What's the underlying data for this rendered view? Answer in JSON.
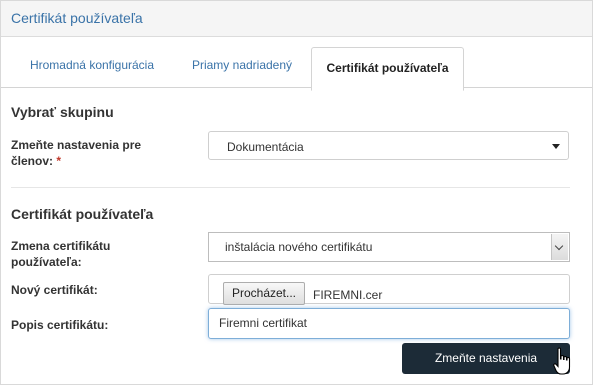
{
  "panel": {
    "title": "Certifikát používateľa"
  },
  "tabs": [
    {
      "label": "Hromadná konfigurácia"
    },
    {
      "label": "Priamy nadriadený"
    },
    {
      "label": "Certifikát používateľa",
      "active": true
    }
  ],
  "group_section": {
    "title": "Vybrať skupinu",
    "field_label_line1": "Zmeňte nastavenia pre",
    "field_label_line2": "členov:",
    "required_mark": "*",
    "selected_value": "Dokumentácia"
  },
  "cert_section": {
    "title": "Certifikát používateľa",
    "change_label_line1": "Zmena certifikátu",
    "change_label_line2": "používateľa:",
    "change_value": "inštalácia nového certifikátu",
    "new_cert_label": "Nový certifikát:",
    "browse_label": "Procházet...",
    "file_name": "FIREMNI.cer",
    "desc_label": "Popis certifikátu:",
    "desc_value": "Firemni certifikat"
  },
  "actions": {
    "submit_label": "Zmeňte nastavenia"
  },
  "colors": {
    "accent": "#3a73a8",
    "button_dark": "#1c2b37",
    "required": "#c0392b"
  },
  "icons": [
    "hand-pointer-icon",
    "dropdown-caret-icon",
    "select-arrow-icon"
  ]
}
